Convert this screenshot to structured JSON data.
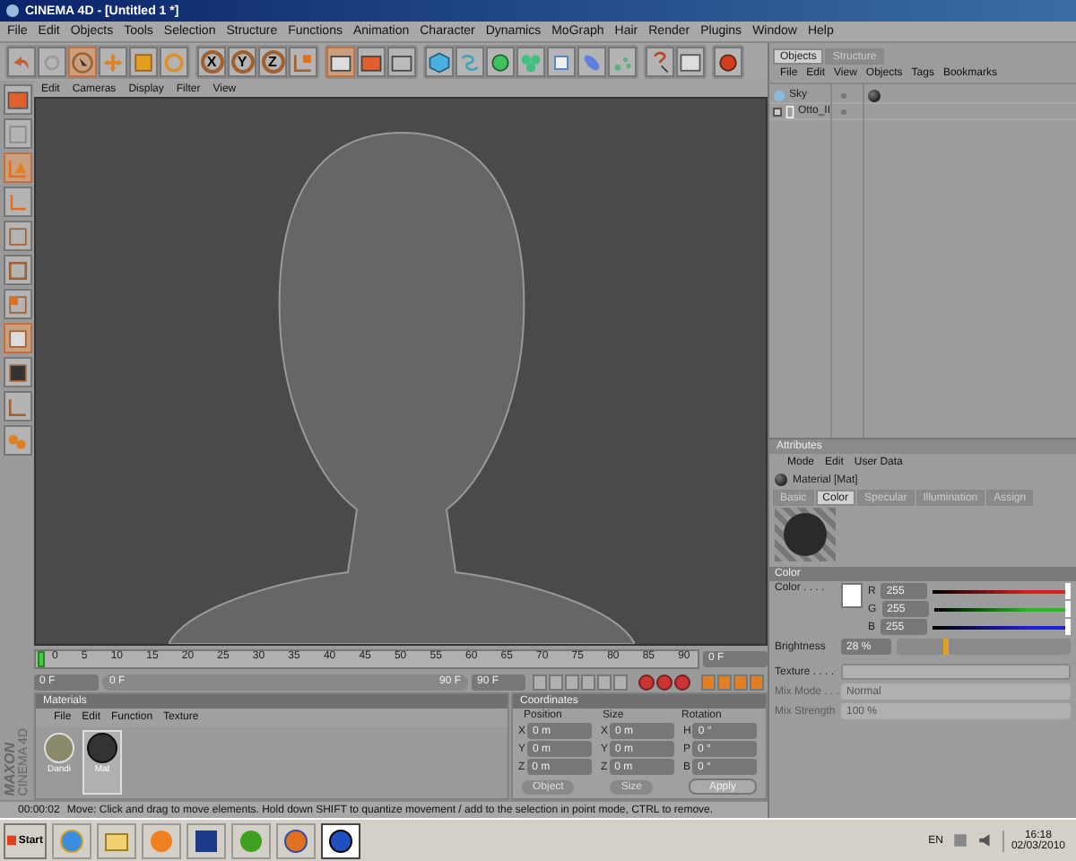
{
  "window": {
    "title": "CINEMA 4D - [Untitled 1 *]"
  },
  "menu": [
    "File",
    "Edit",
    "Objects",
    "Tools",
    "Selection",
    "Structure",
    "Functions",
    "Animation",
    "Character",
    "Dynamics",
    "MoGraph",
    "Hair",
    "Render",
    "Plugins",
    "Window",
    "Help"
  ],
  "toolbar": {
    "axis_buttons": [
      "X",
      "Y",
      "Z"
    ]
  },
  "viewport": {
    "menu": [
      "Edit",
      "Cameras",
      "Display",
      "Filter",
      "View"
    ]
  },
  "objects_panel": {
    "tabs": [
      {
        "label": "Objects",
        "selected": true
      },
      {
        "label": "Structure",
        "selected": false
      }
    ],
    "menu": [
      "File",
      "Edit",
      "View",
      "Objects",
      "Tags",
      "Bookmarks"
    ],
    "items": [
      {
        "name": "Sky",
        "kind": "sky",
        "tag": true
      },
      {
        "name": "Otto_II",
        "kind": "group",
        "tag": false
      }
    ]
  },
  "attributes": {
    "title": "Attributes",
    "menu": [
      "Mode",
      "Edit",
      "User Data"
    ],
    "material": "Material [Mat]",
    "tabs": [
      {
        "label": "Basic",
        "selected": false
      },
      {
        "label": "Color",
        "selected": true
      },
      {
        "label": "Specular",
        "selected": false
      },
      {
        "label": "Illumination",
        "selected": false
      },
      {
        "label": "Assign",
        "selected": false
      }
    ],
    "section": "Color",
    "color_label": "Color . . . .",
    "channels": [
      {
        "letter": "R",
        "value": "255",
        "level": 1,
        "color": "#e02020"
      },
      {
        "letter": "G",
        "value": "255",
        "level": 1,
        "color": "#20c020"
      },
      {
        "letter": "B",
        "value": "255",
        "level": 1,
        "color": "#2020e0"
      }
    ],
    "brightness": {
      "label": "Brightness",
      "value": "28 %",
      "level": 0.28
    },
    "texture_label": "Texture . . . .",
    "mix_mode": {
      "label": "Mix Mode . . .",
      "value": "Normal",
      "disabled": true
    },
    "mix_strength": {
      "label": "Mix Strength",
      "value": "100 %",
      "disabled": true
    }
  },
  "timeline": {
    "ticks": [
      "0",
      "5",
      "10",
      "15",
      "20",
      "25",
      "30",
      "35",
      "40",
      "45",
      "50",
      "55",
      "60",
      "65",
      "70",
      "75",
      "80",
      "85",
      "90"
    ],
    "level": 0,
    "current": "0 F"
  },
  "transport": {
    "start": "0 F",
    "range_start": "0 F",
    "range_end": "90 F",
    "end": "90 F"
  },
  "materials": {
    "title": "Materials",
    "menu": [
      "File",
      "Edit",
      "Function",
      "Texture"
    ],
    "items": [
      {
        "name": "Dandi",
        "kind": "chrome",
        "selected": false
      },
      {
        "name": "Mat",
        "kind": "matte",
        "selected": true
      }
    ]
  },
  "coordinates": {
    "title": "Coordinates",
    "headers": [
      "Position",
      "Size",
      "Rotation"
    ],
    "rows": [
      {
        "position_axis": "X",
        "position": "0 m",
        "size_axis": "X",
        "size": "0 m",
        "rotation_axis": "H",
        "rotation": "0 °"
      },
      {
        "position_axis": "Y",
        "position": "0 m",
        "size_axis": "Y",
        "size": "0 m",
        "rotation_axis": "P",
        "rotation": "0 °"
      },
      {
        "position_axis": "Z",
        "position": "0 m",
        "size_axis": "Z",
        "size": "0 m",
        "rotation_axis": "B",
        "rotation": "0 °"
      }
    ],
    "mode": "Object",
    "size_mode": "Size",
    "apply": "Apply"
  },
  "logo": {
    "brand": "MAXON",
    "product": "CINEMA 4D"
  },
  "status_bar": {
    "time": "00:00:02",
    "message": "Move: Click and drag to move elements. Hold down SHIFT to quantize movement / add to the selection in point mode, CTRL to remove."
  },
  "taskbar": {
    "start": "Start",
    "apps": [
      {
        "selected": false
      },
      {
        "selected": false
      },
      {
        "selected": false
      },
      {
        "selected": false
      },
      {
        "selected": false
      },
      {
        "selected": false
      },
      {
        "selected": true
      }
    ],
    "language": "EN",
    "time": "16:18",
    "date": "02/03/2010"
  }
}
